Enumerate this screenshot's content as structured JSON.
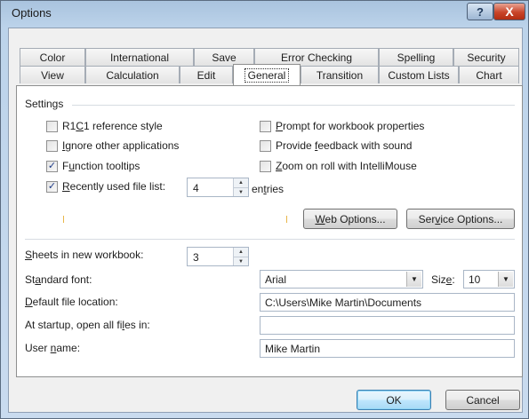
{
  "window": {
    "title": "Options",
    "help_glyph": "?",
    "close_glyph": "X"
  },
  "tabs_row1": [
    "Color",
    "International",
    "Save",
    "Error Checking",
    "Spelling",
    "Security"
  ],
  "tabs_row2": [
    "View",
    "Calculation",
    "Edit",
    "General",
    "Transition",
    "Custom Lists",
    "Chart"
  ],
  "active_tab": "General",
  "settings": {
    "group_label": "Settings",
    "r1c1": {
      "label_pre": "R1",
      "label_u": "C",
      "label_post": "1 reference style",
      "checked": false
    },
    "ignore_apps": {
      "label_u": "I",
      "label_post": "gnore other applications",
      "checked": false
    },
    "function_tooltips": {
      "label_pre": "F",
      "label_u": "u",
      "label_post": "nction tooltips",
      "checked": true
    },
    "recent_files": {
      "label_u": "R",
      "label_post": "ecently used file list:",
      "checked": true,
      "value": "4",
      "suffix_pre": "en",
      "suffix_u": "t",
      "suffix_post": "ries"
    },
    "prompt_props": {
      "label_u": "P",
      "label_post": "rompt for workbook properties",
      "checked": false
    },
    "feedback_sound": {
      "label_pre": "Provide ",
      "label_u": "f",
      "label_post": "eedback with sound",
      "checked": false
    },
    "zoom_roll": {
      "label_u": "Z",
      "label_post": "oom on roll with IntelliMouse",
      "checked": false
    },
    "web_options": {
      "label_u": "W",
      "label_post": "eb Options..."
    },
    "service_options": {
      "label_pre": "Ser",
      "label_u": "v",
      "label_post": "ice Options..."
    }
  },
  "workbook": {
    "sheets_label_u": "S",
    "sheets_label_post": "heets in new workbook:",
    "sheets_value": "3",
    "font_label_pre": "St",
    "font_label_u": "a",
    "font_label_post": "ndard font:",
    "font_value": "Arial",
    "size_label_pre": "Siz",
    "size_label_u": "e",
    "size_label_post": ":",
    "size_value": "10",
    "location_label_u": "D",
    "location_label_post": "efault file location:",
    "location_value": "C:\\Users\\Mike Martin\\Documents",
    "startup_label_pre": "At startup, open all fi",
    "startup_label_u": "l",
    "startup_label_post": "es in:",
    "startup_value": "",
    "user_label_pre": "User ",
    "user_label_u": "n",
    "user_label_post": "ame:",
    "user_value": "Mike Martin"
  },
  "buttons": {
    "ok": "OK",
    "cancel": "Cancel"
  },
  "colors": {
    "title_gradient": "#bcd3ea",
    "check_color": "#1f3c88",
    "default_button": "#3c7fb1"
  }
}
